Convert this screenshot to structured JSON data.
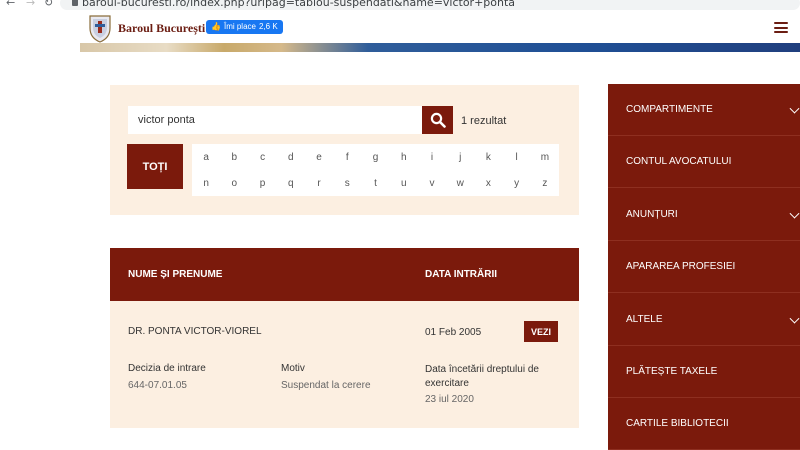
{
  "browser": {
    "back_icon": "arrow-left-icon",
    "forward_icon": "arrow-right-icon",
    "reload_icon": "reload-icon",
    "url": "baroul-bucuresti.ro/index.php?urlpag=tablou-suspendati&name=victor+ponta"
  },
  "header": {
    "brand": "Baroul București",
    "like_label": "Îmi place",
    "like_count": "2,6 K",
    "menu_icon": "hamburger-menu-icon"
  },
  "search": {
    "query": "victor ponta",
    "button_icon": "search-icon",
    "results_text": "1 rezultat",
    "all_label": "TOȚI",
    "letters_row1": [
      "a",
      "b",
      "c",
      "d",
      "e",
      "f",
      "g",
      "h",
      "i",
      "j",
      "k",
      "l",
      "m"
    ],
    "letters_row2": [
      "n",
      "o",
      "p",
      "q",
      "r",
      "s",
      "t",
      "u",
      "v",
      "w",
      "x",
      "y",
      "z"
    ]
  },
  "table": {
    "headers": {
      "name": "NUME ȘI PRENUME",
      "date": "DATA INTRĂRII"
    },
    "row": {
      "name": "DR. PONTA VICTOR-VIOREL",
      "date": "01 Feb 2005",
      "view_label": "VEZI",
      "decision_label": "Decizia de intrare",
      "decision_value": "644-07.01.05",
      "reason_label": "Motiv",
      "reason_value": "Suspendat la cerere",
      "end_label": "Data încetării dreptului de exercitare",
      "end_value": "23 iul 2020"
    }
  },
  "side_menu": {
    "items": [
      {
        "label": "COMPARTIMENTE",
        "has_submenu": true
      },
      {
        "label": "CONTUL AVOCATULUI",
        "has_submenu": false
      },
      {
        "label": "ANUNȚURI",
        "has_submenu": true
      },
      {
        "label": "APARAREA PROFESIEI",
        "has_submenu": false
      },
      {
        "label": "ALTELE",
        "has_submenu": true
      },
      {
        "label": "PLĂTEȘTE TAXELE",
        "has_submenu": false
      },
      {
        "label": "CARTILE BIBLIOTECII",
        "has_submenu": false
      }
    ]
  },
  "colors": {
    "primary": "#7b1a0c",
    "panel_bg": "#fcefe1",
    "facebook": "#1877f2"
  }
}
